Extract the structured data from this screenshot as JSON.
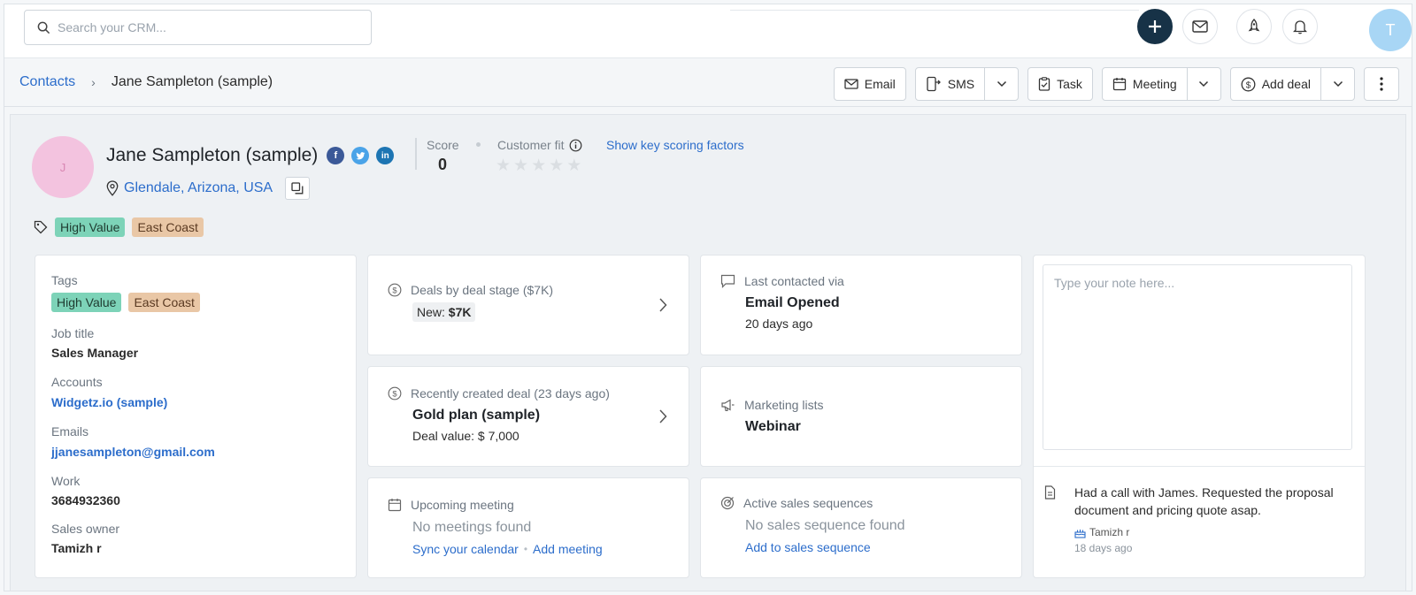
{
  "search": {
    "placeholder": "Search your CRM..."
  },
  "user": {
    "initial": "T"
  },
  "breadcrumb": {
    "parent": "Contacts",
    "separator": "›",
    "current": "Jane Sampleton (sample)"
  },
  "actions": {
    "email": "Email",
    "sms": "SMS",
    "task": "Task",
    "meeting": "Meeting",
    "add_deal": "Add deal"
  },
  "contact": {
    "initial": "J",
    "name": "Jane Sampleton (sample)",
    "location": "Glendale, Arizona, USA",
    "score_label": "Score",
    "score_value": "0",
    "fit_label": "Customer fit",
    "fit_rating": 0,
    "key_factors": "Show key scoring factors",
    "tags": [
      "High Value",
      "East Coast"
    ]
  },
  "details": {
    "tags_label": "Tags",
    "job_title_label": "Job title",
    "job_title": "Sales Manager",
    "accounts_label": "Accounts",
    "account": "Widgetz.io (sample)",
    "emails_label": "Emails",
    "email": "jjanesampleton@gmail.com",
    "work_label": "Work",
    "work": "3684932360",
    "owner_label": "Sales owner",
    "owner": "Tamizh r"
  },
  "deals_stage": {
    "title": "Deals by deal stage ($7K)",
    "pill_label": "New:",
    "pill_value": "$7K"
  },
  "recent_deal": {
    "title": "Recently created deal (23 days ago)",
    "name": "Gold plan (sample)",
    "value": "Deal value: $ 7,000"
  },
  "meeting": {
    "title": "Upcoming meeting",
    "empty": "No meetings found",
    "sync": "Sync your calendar",
    "bullet": "•",
    "add": "Add meeting"
  },
  "last_contact": {
    "title": "Last contacted via",
    "value": "Email Opened",
    "when": "20 days ago"
  },
  "marketing": {
    "title": "Marketing lists",
    "value": "Webinar"
  },
  "sequences": {
    "title": "Active sales sequences",
    "empty": "No sales sequence found",
    "add": "Add to sales sequence"
  },
  "note": {
    "placeholder": "Type your note here...",
    "text": "Had a call with James. Requested the proposal document and pricing quote asap.",
    "author": "Tamizh r",
    "when": "18 days ago"
  },
  "colors": {
    "accent": "#2c6dcb",
    "primary_dark": "#173247",
    "tag_green": "#7dd3b8",
    "tag_tan": "#e9c7a6"
  }
}
